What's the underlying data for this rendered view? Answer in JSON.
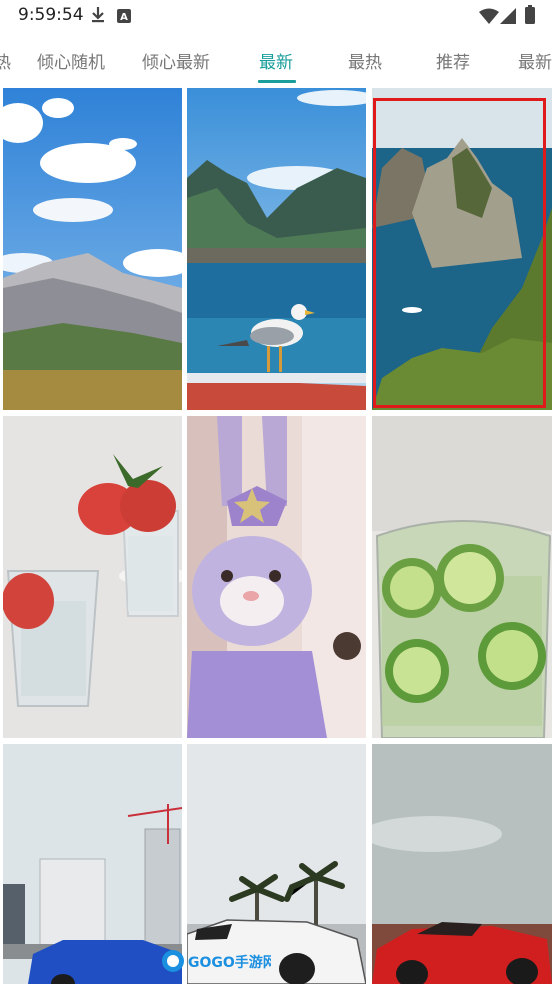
{
  "status_bar": {
    "time": "9:59:54",
    "a_badge": "A",
    "icons": [
      "download-icon",
      "a-badge-icon",
      "wifi-icon",
      "signal-icon",
      "battery-icon"
    ]
  },
  "tabs": {
    "items": [
      {
        "label": "热"
      },
      {
        "label": "倾心随机"
      },
      {
        "label": "倾心最新"
      },
      {
        "label": "最新",
        "active": true
      },
      {
        "label": "最热"
      },
      {
        "label": "推荐"
      },
      {
        "label": "最新"
      }
    ],
    "accent": "#1a9e9b"
  },
  "wallpapers": [
    {
      "subject": "mountain-meadow-blue-sky"
    },
    {
      "subject": "seagull-on-railing-fjord"
    },
    {
      "subject": "sea-stacks-island-coast",
      "selected": true
    },
    {
      "subject": "tomato-slices-water-glasses"
    },
    {
      "subject": "purple-bunny-plush-toy"
    },
    {
      "subject": "cucumber-drink-glass"
    },
    {
      "subject": "city-skyline-blue-car"
    },
    {
      "subject": "palm-trees-white-sports-car"
    },
    {
      "subject": "red-sports-car-sea"
    }
  ],
  "watermark": {
    "text": "GOGO手游网"
  },
  "selection_color": "#e01a1a"
}
